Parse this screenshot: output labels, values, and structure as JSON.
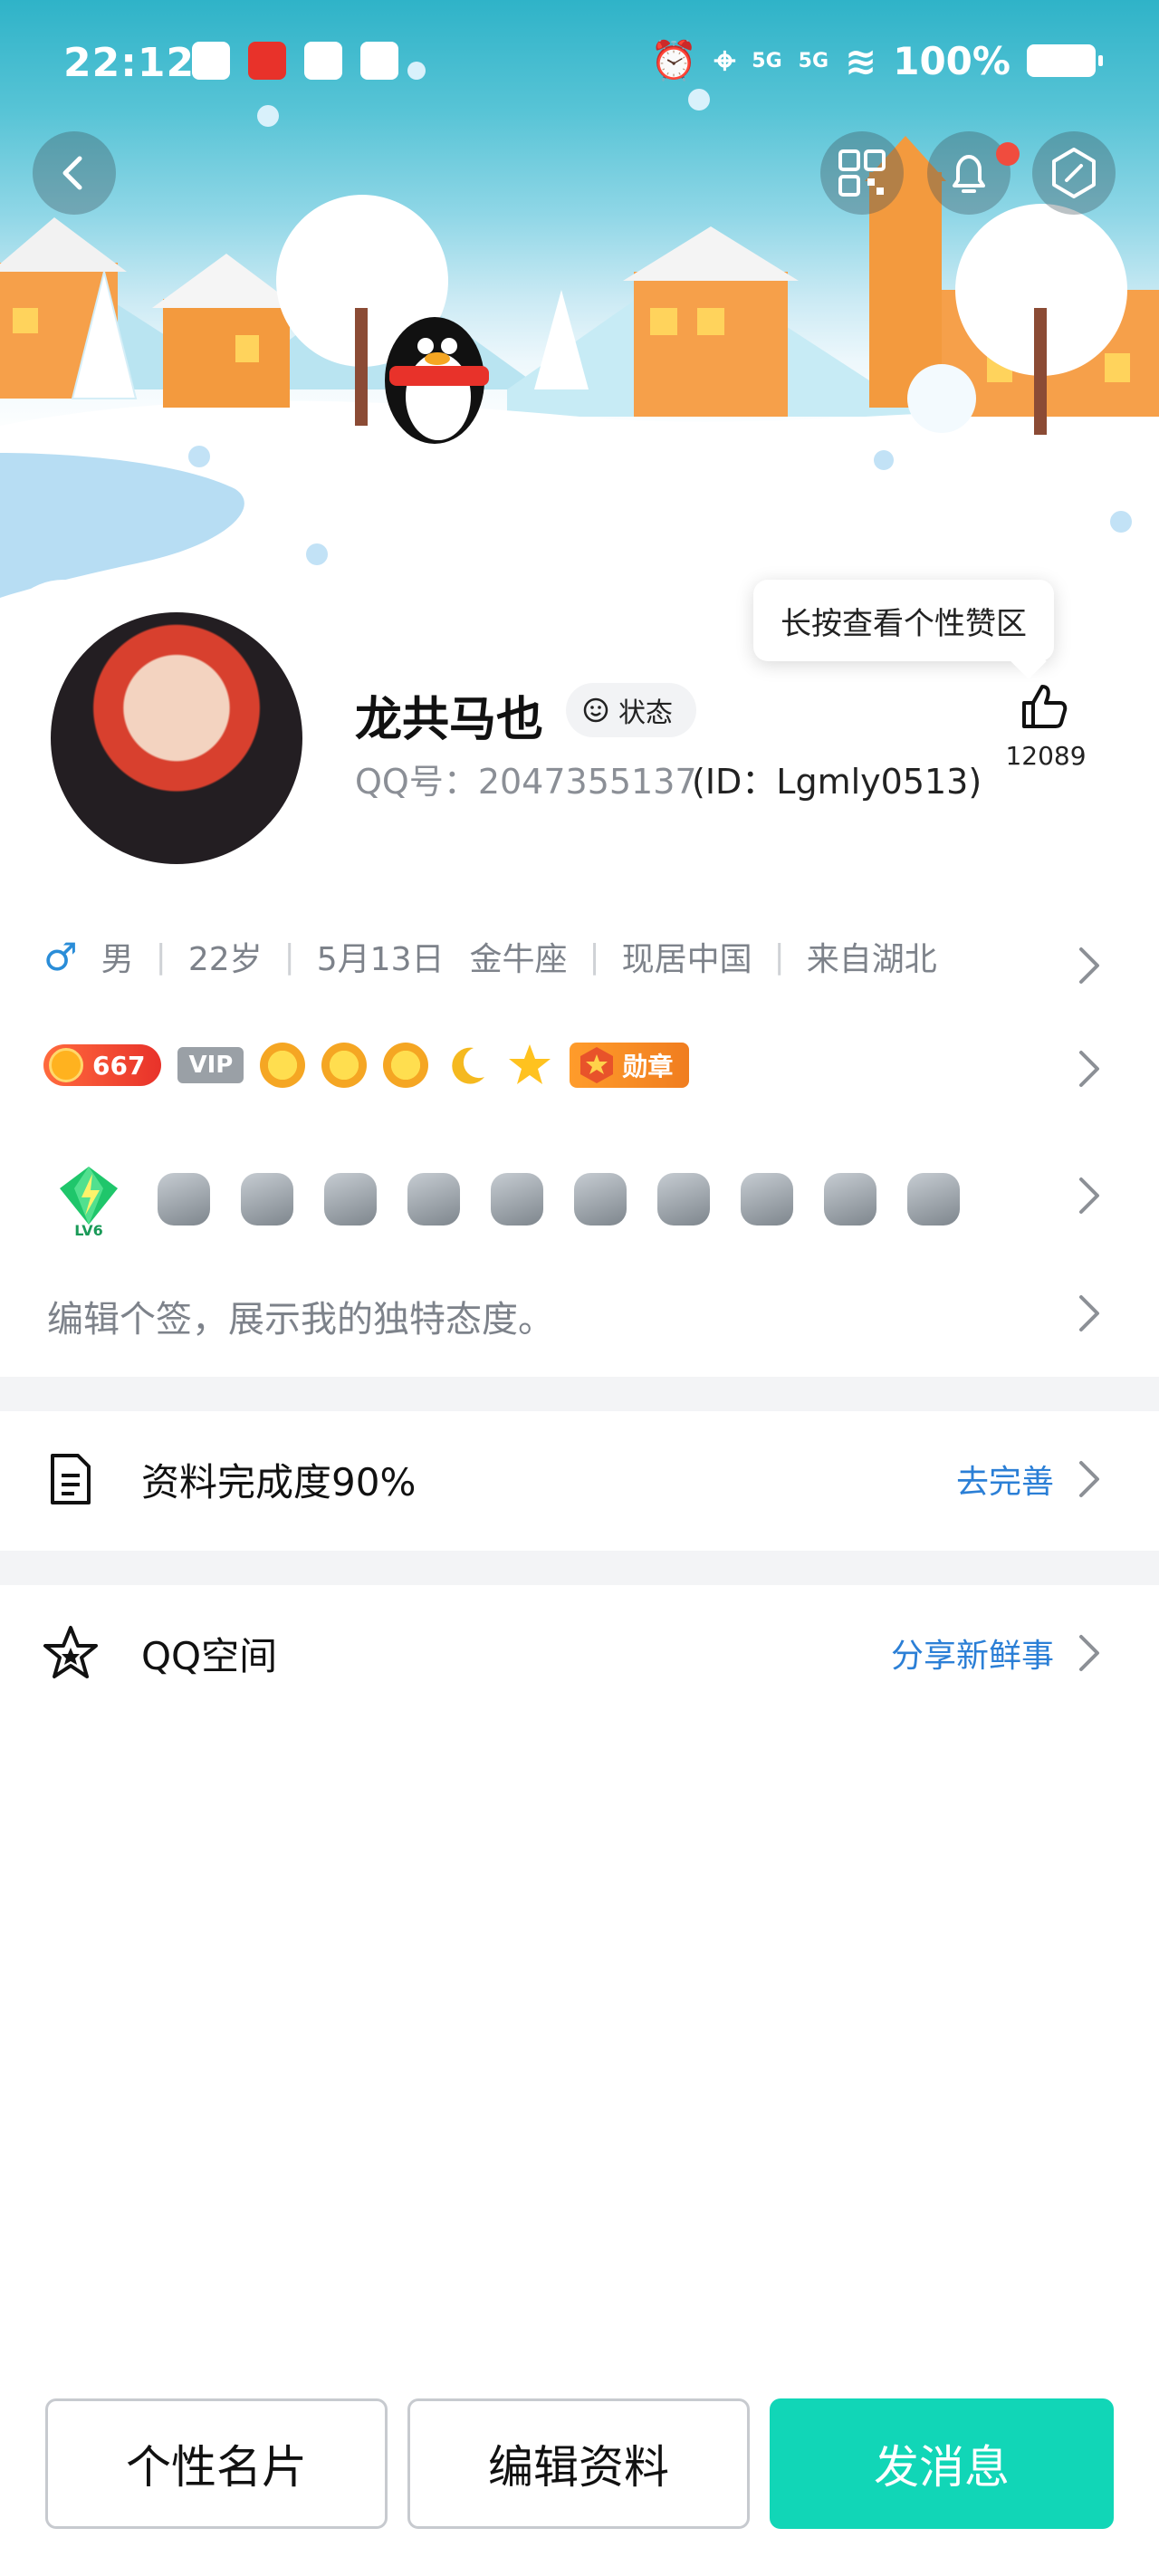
{
  "status_bar": {
    "time": "22:12",
    "battery": "100%",
    "network_1": "5G",
    "network_2": "5G"
  },
  "header": {
    "back_icon": "chevron-left-icon",
    "qr_icon": "qr-code-icon",
    "bell_icon": "bell-icon",
    "settings_icon": "hexagon-settings-icon"
  },
  "profile": {
    "nickname": "龙共马也",
    "status_label": "状态",
    "qq_label": "QQ号：2047355137",
    "id_label": "(ID：Lgmly0513)",
    "tooltip": "长按查看个性赞区",
    "like_count": "12089"
  },
  "info": {
    "gender_symbol": "♂",
    "items": [
      "男",
      "22岁",
      "5月13日",
      "金牛座",
      "现居中国",
      "来自湖北"
    ]
  },
  "badges": {
    "coin_count": "667",
    "vip_label": "VIP",
    "medal_label": "勋章"
  },
  "signature": "编辑个签，展示我的独特态度。",
  "rows": {
    "profile_complete": {
      "label": "资料完成度90%",
      "action": "去完善"
    },
    "qzone": {
      "label": "QQ空间",
      "action": "分享新鲜事"
    }
  },
  "buttons": {
    "card": "个性名片",
    "edit": "编辑资料",
    "message": "发消息"
  },
  "colors": {
    "accent": "#11d6b7",
    "link": "#2b7fd6",
    "male": "#2a8dd8",
    "notif": "#f04c3e"
  }
}
